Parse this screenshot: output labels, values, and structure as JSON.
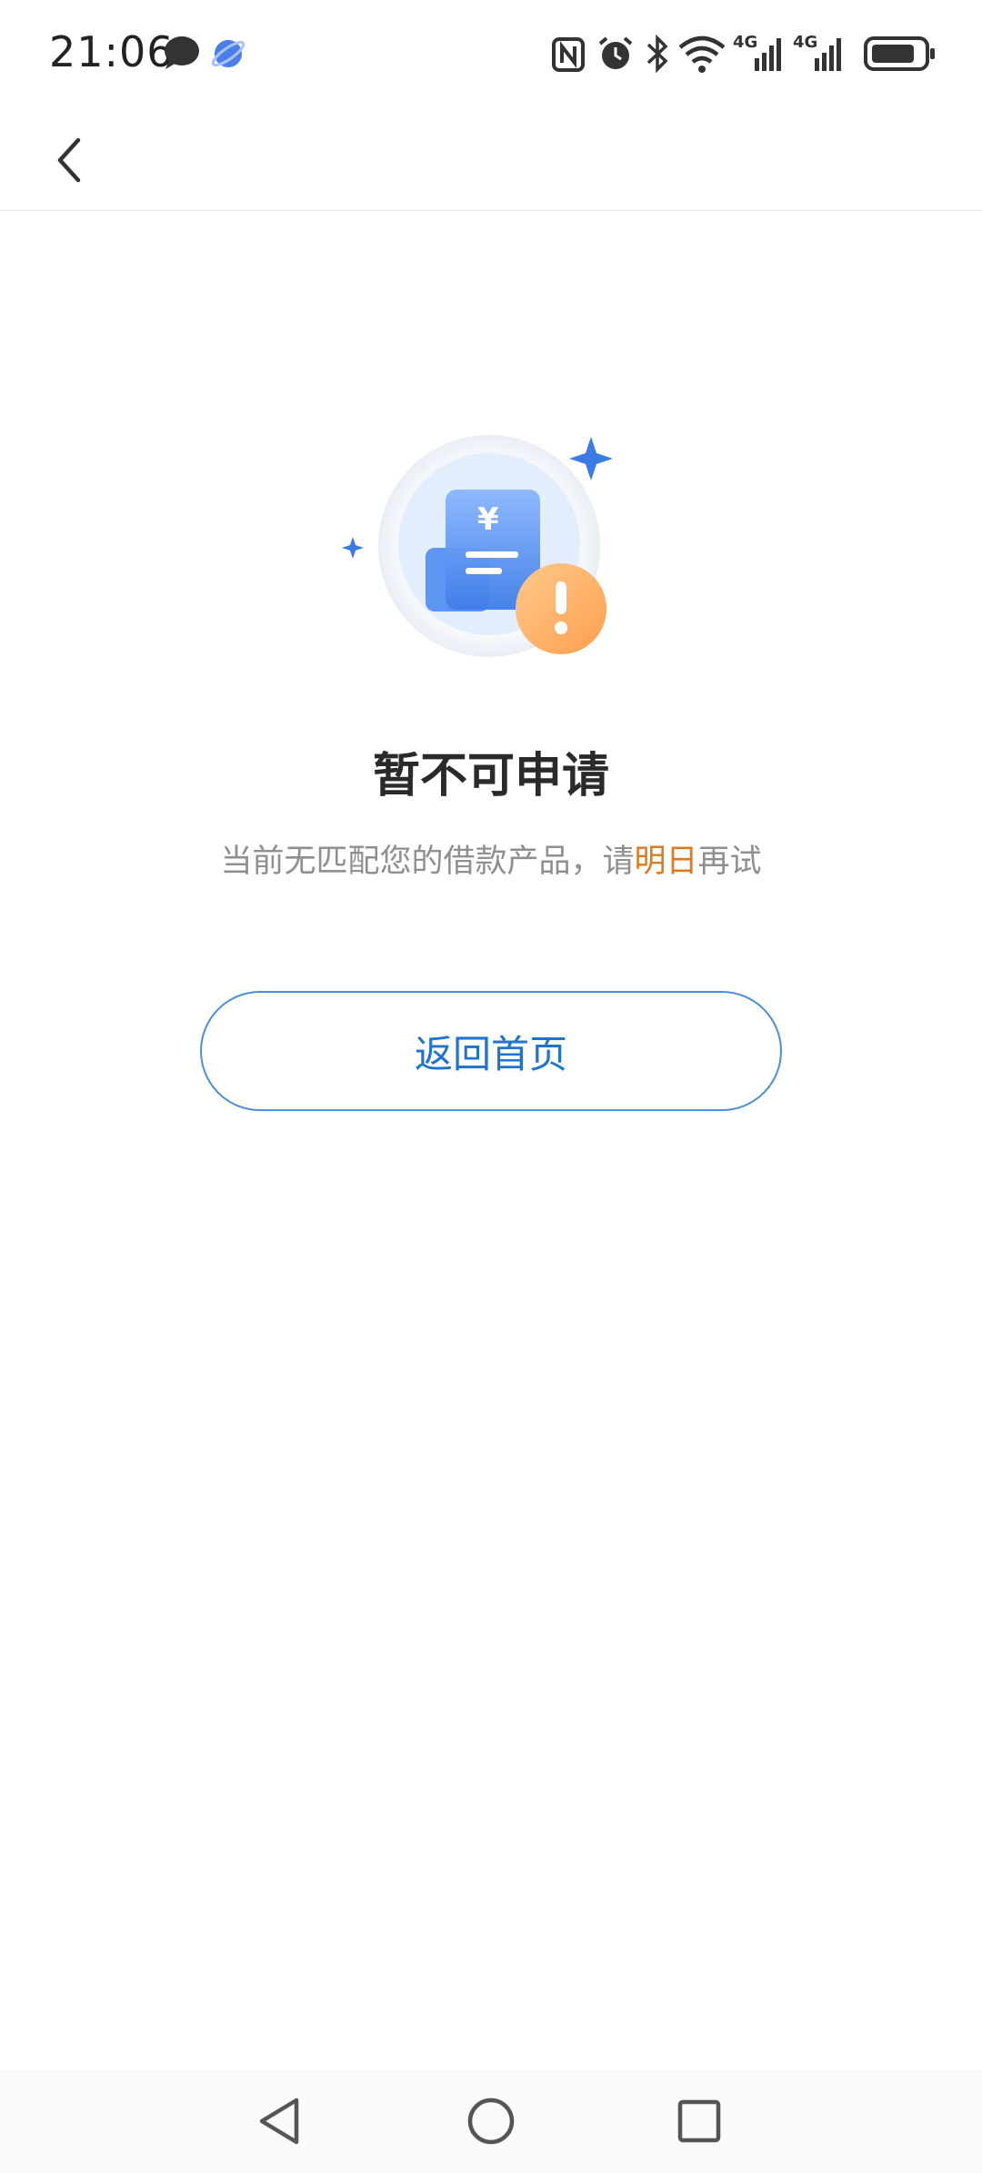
{
  "status_bar": {
    "time": "21:06",
    "network_1": "4G",
    "network_2": "4G",
    "icons": [
      "chat-bubble-icon",
      "planet-app-icon",
      "nfc-icon",
      "alarm-icon",
      "bluetooth-icon",
      "wifi-icon",
      "signal-icon",
      "battery-icon"
    ]
  },
  "nav": {
    "back_icon": "chevron-left-icon"
  },
  "main": {
    "title": "暂不可申请",
    "subtitle_before": "当前无匹配您的借款产品，请",
    "subtitle_highlight": "明日",
    "subtitle_after": "再试",
    "home_button_label": "返回首页"
  },
  "illustration": {
    "currency_symbol": "¥"
  },
  "colors": {
    "accent_blue": "#1f74d0",
    "highlight_orange": "#e07a1f",
    "warning_orange": "#ffa75a"
  },
  "system_nav": {
    "icons": [
      "back-triangle-icon",
      "home-circle-icon",
      "recents-square-icon"
    ]
  }
}
